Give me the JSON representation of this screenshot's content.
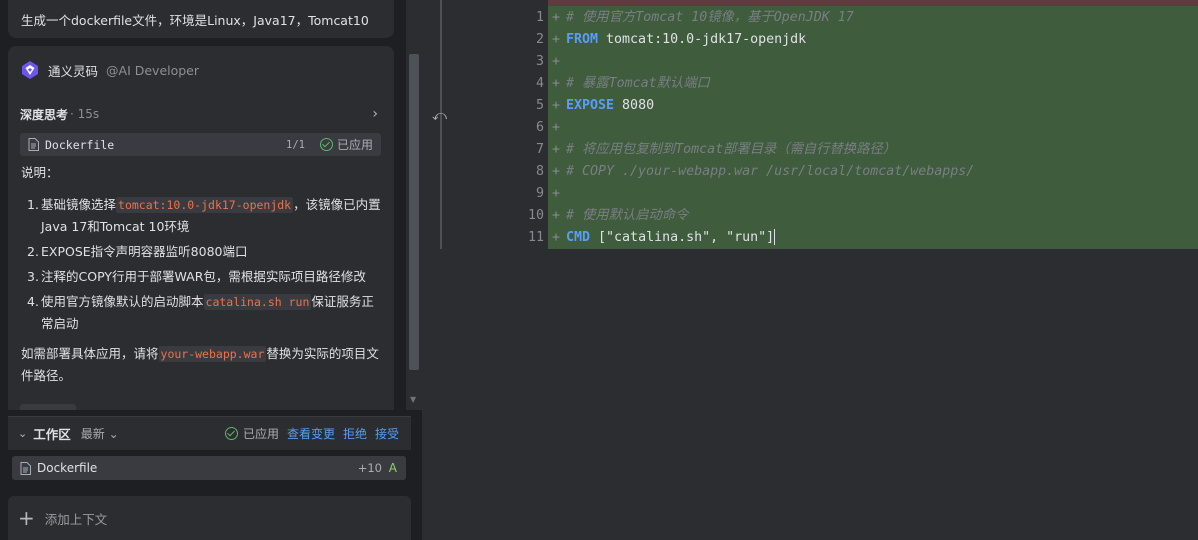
{
  "chat": {
    "user_message": "生成一个dockerfile文件，环境是Linux，Java17，Tomcat10",
    "assistant_name": "通义灵码",
    "assistant_handle": "@AI Developer",
    "thinking_label": "深度思考",
    "thinking_time": "· 15s",
    "file_chip": {
      "name": "Dockerfile",
      "count": "1/1",
      "status": "已应用"
    },
    "explain_label": "说明：",
    "steps": [
      {
        "num": "1.",
        "before": "基础镜像选择",
        "code": "tomcat:10.0-jdk17-openjdk",
        "after": "，该镜像已内置Java 17和Tomcat 10环境"
      },
      {
        "num": "2.",
        "before": "EXPOSE指令声明容器监听8080端口",
        "code": "",
        "after": ""
      },
      {
        "num": "3.",
        "before": "注释的COPY行用于部署WAR包，需根据实际项目路径修改",
        "code": "",
        "after": ""
      },
      {
        "num": "4.",
        "before": "使用官方镜像默认的启动脚本",
        "code": "catalina.sh run",
        "after": "保证服务正常启动"
      }
    ],
    "outro": {
      "before": "如需部署具体应用，请将",
      "code": "your-webapp.war",
      "after": "替换为实际的项目文件路径。"
    }
  },
  "workspace": {
    "title": "工作区",
    "sort": "最新",
    "applied": "已应用",
    "view_changes": "查看变更",
    "reject": "拒绝",
    "accept": "接受",
    "file": {
      "name": "Dockerfile",
      "delta": "+10",
      "status": "A"
    }
  },
  "context": {
    "add_label": "添加上下文"
  },
  "editor": {
    "lines": [
      {
        "num": "1",
        "mark": "+",
        "parts": [
          {
            "t": "# 使用官方Tomcat 10镜像，基于OpenJDK 17",
            "c": "cmt"
          }
        ]
      },
      {
        "num": "2",
        "mark": "+",
        "parts": [
          {
            "t": "FROM",
            "c": "kw"
          },
          {
            "t": " tomcat:10.0-jdk17-openjdk",
            "c": ""
          }
        ]
      },
      {
        "num": "3",
        "mark": "+",
        "parts": []
      },
      {
        "num": "4",
        "mark": "+",
        "parts": [
          {
            "t": "# 暴露Tomcat默认端口",
            "c": "cmt"
          }
        ]
      },
      {
        "num": "5",
        "mark": "+",
        "parts": [
          {
            "t": "EXPOSE",
            "c": "kw"
          },
          {
            "t": " 8080",
            "c": ""
          }
        ]
      },
      {
        "num": "6",
        "mark": "+",
        "parts": []
      },
      {
        "num": "7",
        "mark": "+",
        "parts": [
          {
            "t": "# 将应用包复制到Tomcat部署目录（需自行替换路径）",
            "c": "cmt"
          }
        ]
      },
      {
        "num": "8",
        "mark": "+",
        "parts": [
          {
            "t": "# COPY ./your-webapp.war /usr/local/tomcat/webapps/",
            "c": "cmt"
          }
        ]
      },
      {
        "num": "9",
        "mark": "+",
        "parts": []
      },
      {
        "num": "10",
        "mark": "+",
        "parts": [
          {
            "t": "# 使用默认启动命令",
            "c": "cmt"
          }
        ]
      },
      {
        "num": "11",
        "mark": "+",
        "parts": [
          {
            "t": "CMD",
            "c": "kw"
          },
          {
            "t": " [\"catalina.sh\", \"run\"]",
            "c": ""
          }
        ]
      }
    ]
  }
}
